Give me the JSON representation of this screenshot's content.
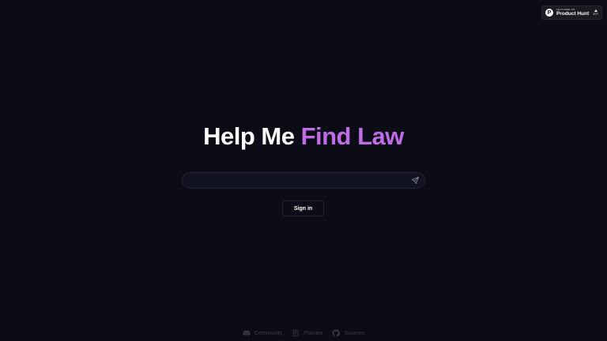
{
  "product_hunt_badge": {
    "small_text": "FEATURED ON",
    "name": "Product Hunt",
    "logo_letter": "P",
    "votes": "277"
  },
  "title": {
    "white": "Help Me ",
    "accent": "Find Law",
    "accent_color": "#c06ce6"
  },
  "search": {
    "value": "",
    "placeholder": "",
    "send_icon": "send-icon"
  },
  "auth": {
    "sign_in_label": "Sign in"
  },
  "footer": {
    "links": [
      {
        "label": "Community",
        "icon": "discord-icon"
      },
      {
        "label": "Policies",
        "icon": "document-icon"
      },
      {
        "label": "Sources",
        "icon": "github-icon"
      }
    ]
  },
  "colors": {
    "background": "#0c0c16",
    "accent": "#c06ce6",
    "footer_text": "#3a3b48"
  }
}
